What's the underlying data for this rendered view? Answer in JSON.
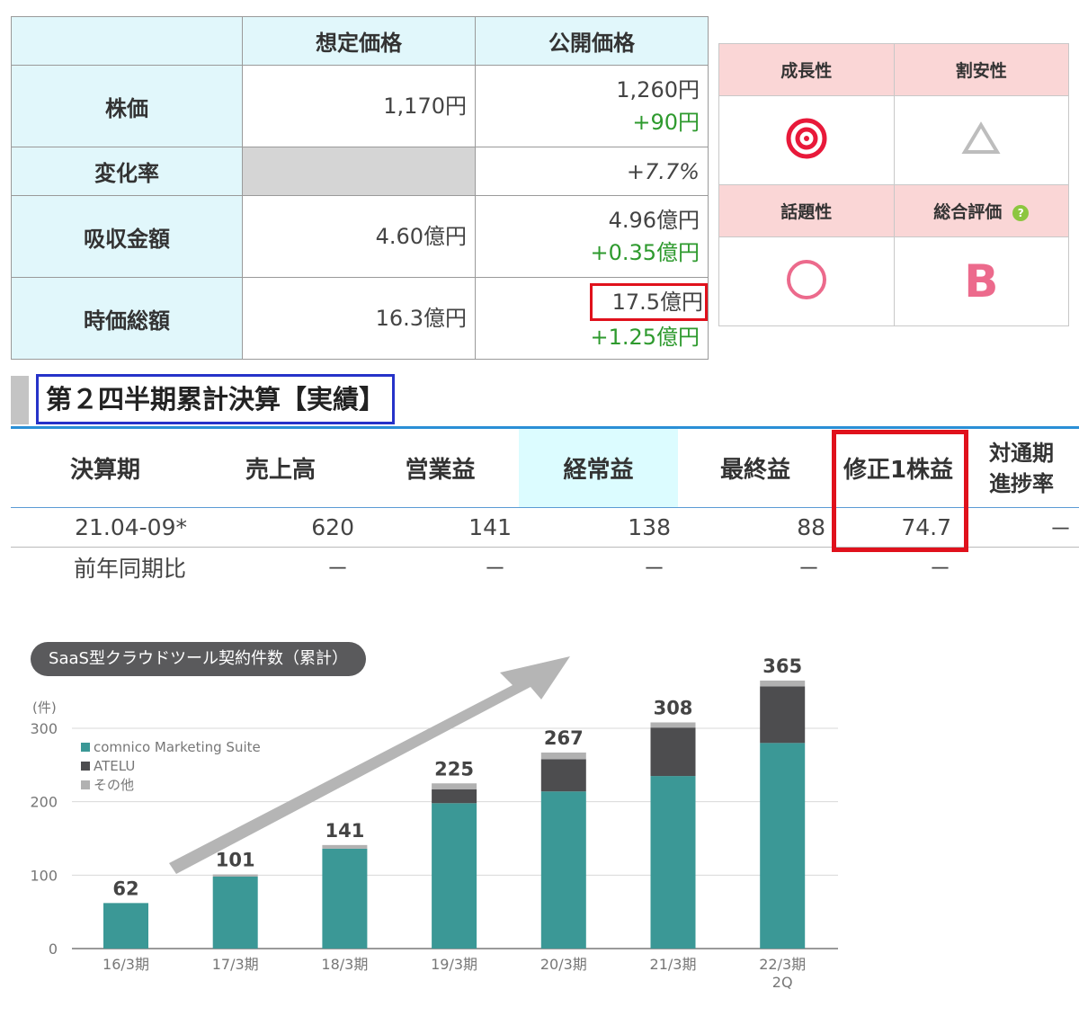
{
  "price_table": {
    "headers": [
      "想定価格",
      "公開価格"
    ],
    "rows": [
      {
        "label": "株価",
        "estimated": "1,170円",
        "public": "1,260円",
        "public_change": "+90円"
      },
      {
        "label": "変化率",
        "estimated": "",
        "public": "+7.7%",
        "public_change": ""
      },
      {
        "label": "吸収金額",
        "estimated": "4.60億円",
        "public": "4.96億円",
        "public_change": "+0.35億円"
      },
      {
        "label": "時価総額",
        "estimated": "16.3億円",
        "public": "17.5億円",
        "public_change": "+1.25億円"
      }
    ]
  },
  "evaluation": {
    "items": [
      {
        "label": "成長性",
        "mark": "double-circle"
      },
      {
        "label": "割安性",
        "mark": "triangle"
      },
      {
        "label": "話題性",
        "mark": "circle"
      },
      {
        "label": "総合評価",
        "grade": "B",
        "help": "?"
      }
    ]
  },
  "section_title": "第２四半期累計決算【実績】",
  "results": {
    "headers": [
      "決算期",
      "売上高",
      "営業益",
      "経常益",
      "最終益",
      "修正1株益",
      "対通期",
      "進捗率"
    ],
    "rows": [
      [
        "21.04-09*",
        "620",
        "141",
        "138",
        "88",
        "74.7",
        "－"
      ],
      [
        "前年同期比",
        "－",
        "－",
        "－",
        "－",
        "－",
        ""
      ]
    ]
  },
  "chart_data": {
    "type": "bar",
    "title": "SaaS型クラウドツール契約件数（累計）",
    "unit_label": "(件)",
    "categories": [
      "16/3期",
      "17/3期",
      "18/3期",
      "19/3期",
      "20/3期",
      "21/3期",
      "22/3期 2Q"
    ],
    "totals": [
      62,
      101,
      141,
      225,
      267,
      308,
      365
    ],
    "series": [
      {
        "name": "comnico Marketing Suite",
        "color": "#3b9896",
        "values": [
          62,
          98,
          136,
          198,
          214,
          235,
          280
        ]
      },
      {
        "name": "ATELU",
        "color": "#4d4d4f",
        "values": [
          0,
          0,
          0,
          19,
          44,
          66,
          77
        ]
      },
      {
        "name": "その他",
        "color": "#b1b1b1",
        "values": [
          0,
          3,
          5,
          8,
          9,
          7,
          8
        ]
      }
    ],
    "ylim": [
      0,
      360
    ],
    "yticks": [
      0,
      100,
      200,
      300
    ],
    "stacked": true,
    "grid": true,
    "legend": "top-left"
  },
  "colors": {
    "accent_cyan": "#e1f7fb",
    "pink": "#fad6d6",
    "green": "#2e9a2e",
    "red": "#e0111c",
    "blue": "#2633c9"
  }
}
